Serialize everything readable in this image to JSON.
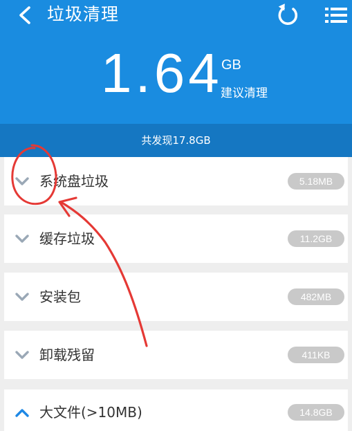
{
  "header": {
    "title": "垃圾清理",
    "back_icon": "chevron-left-icon",
    "refresh_icon": "refresh-icon",
    "menu_icon": "list-menu-icon",
    "background_color": "#1a8ce0"
  },
  "summary": {
    "size_value": "1.64",
    "size_unit": "GB",
    "hint": "建议清理",
    "found_text": "共发现17.8GB",
    "found_bar_color": "#1577c2"
  },
  "categories": [
    {
      "label": "系统盘垃圾",
      "size": "5.18MB",
      "expanded": false
    },
    {
      "label": "缓存垃圾",
      "size": "11.2GB",
      "expanded": false
    },
    {
      "label": "安装包",
      "size": "482MB",
      "expanded": false
    },
    {
      "label": "卸载残留",
      "size": "411KB",
      "expanded": false
    },
    {
      "label": "大文件(>10MB)",
      "size": "14.8GB",
      "expanded": true
    }
  ],
  "annotation": {
    "color": "#e53935",
    "shapes": [
      "circle",
      "arrow"
    ]
  }
}
